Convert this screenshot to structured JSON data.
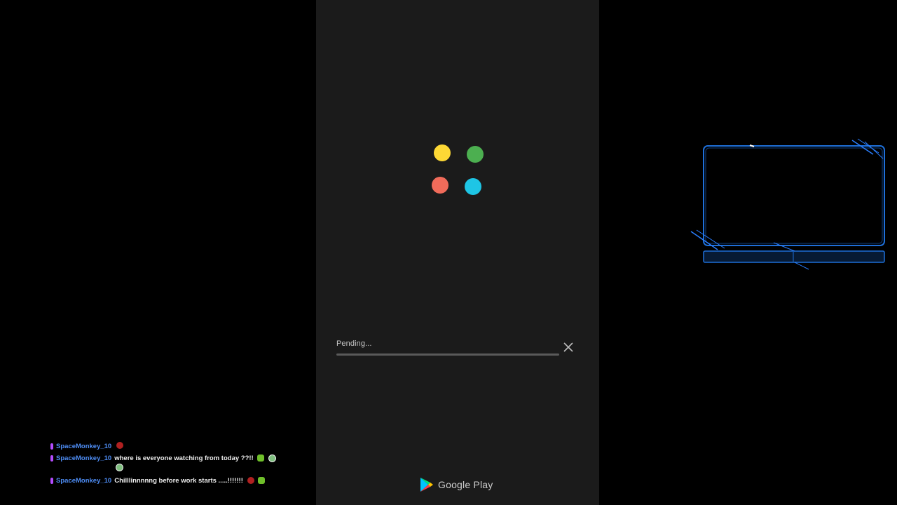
{
  "phone": {
    "loading_dots": [
      {
        "name": "yellow",
        "color": "#fdd835"
      },
      {
        "name": "green",
        "color": "#4caf50"
      },
      {
        "name": "red",
        "color": "#f06b5a"
      },
      {
        "name": "cyan",
        "color": "#1ec5e5"
      }
    ],
    "download": {
      "status": "Pending...",
      "progress_percent": 0,
      "close_icon": "close-icon"
    },
    "footer": {
      "brand": "Google Play",
      "logo_icon": "google-play-logo-icon"
    }
  },
  "overlay": {
    "frame_color": "#1e6fd9"
  },
  "chat": {
    "username_color": "#4e8df5",
    "messages": [
      {
        "user": "SpaceMonkey_10",
        "text": "",
        "emotes": [
          "red-emote"
        ]
      },
      {
        "user": "SpaceMonkey_10",
        "text": "where is everyone watching from today ??!!",
        "emotes": [
          "green-emote",
          "globe-emote",
          "globe-emote"
        ]
      },
      {
        "user": "SpaceMonkey_10",
        "text": "Chilllinnnnng before work starts .....!!!!!!!",
        "emotes": [
          "red-emote",
          "green-emote"
        ]
      }
    ]
  }
}
